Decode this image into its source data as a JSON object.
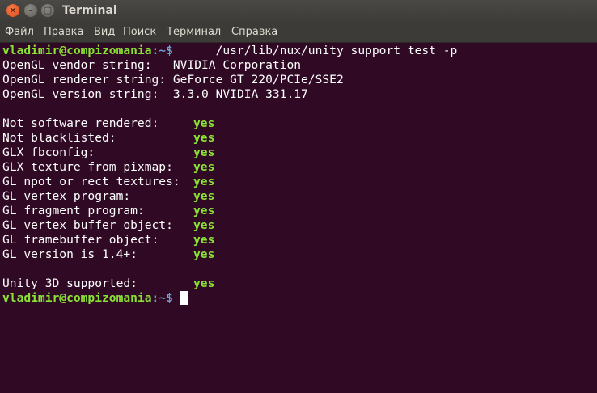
{
  "window": {
    "title": "Terminal",
    "buttons": {
      "close": "×",
      "minimize": "–",
      "maximize": "□"
    }
  },
  "menu": [
    "Файл",
    "Правка",
    "Вид",
    "Поиск",
    "Терминал",
    "Справка"
  ],
  "terminal": {
    "prompt_user": "vladimir@compizomania",
    "prompt_path": ":~$",
    "command": "      /usr/lib/nux/unity_support_test -p",
    "info": [
      "OpenGL vendor string:   NVIDIA Corporation",
      "OpenGL renderer string: GeForce GT 220/PCIe/SSE2",
      "OpenGL version string:  3.3.0 NVIDIA 331.17"
    ],
    "checks": [
      {
        "label": "Not software rendered:",
        "value": "yes"
      },
      {
        "label": "Not blacklisted:",
        "value": "yes"
      },
      {
        "label": "GLX fbconfig:",
        "value": "yes"
      },
      {
        "label": "GLX texture from pixmap:",
        "value": "yes"
      },
      {
        "label": "GL npot or rect textures:",
        "value": "yes"
      },
      {
        "label": "GL vertex program:",
        "value": "yes"
      },
      {
        "label": "GL fragment program:",
        "value": "yes"
      },
      {
        "label": "GL vertex buffer object:",
        "value": "yes"
      },
      {
        "label": "GL framebuffer object:",
        "value": "yes"
      },
      {
        "label": "GL version is 1.4+:",
        "value": "yes"
      }
    ],
    "summary": {
      "label": "Unity 3D supported:",
      "value": "yes"
    },
    "final_prompt_user": "vladimir@compizomania",
    "final_prompt_path": ":~$"
  },
  "colors": {
    "background": "#300a24",
    "prompt_green": "#8ae234",
    "path_blue": "#729fcf",
    "close_orange": "#df4a16"
  }
}
